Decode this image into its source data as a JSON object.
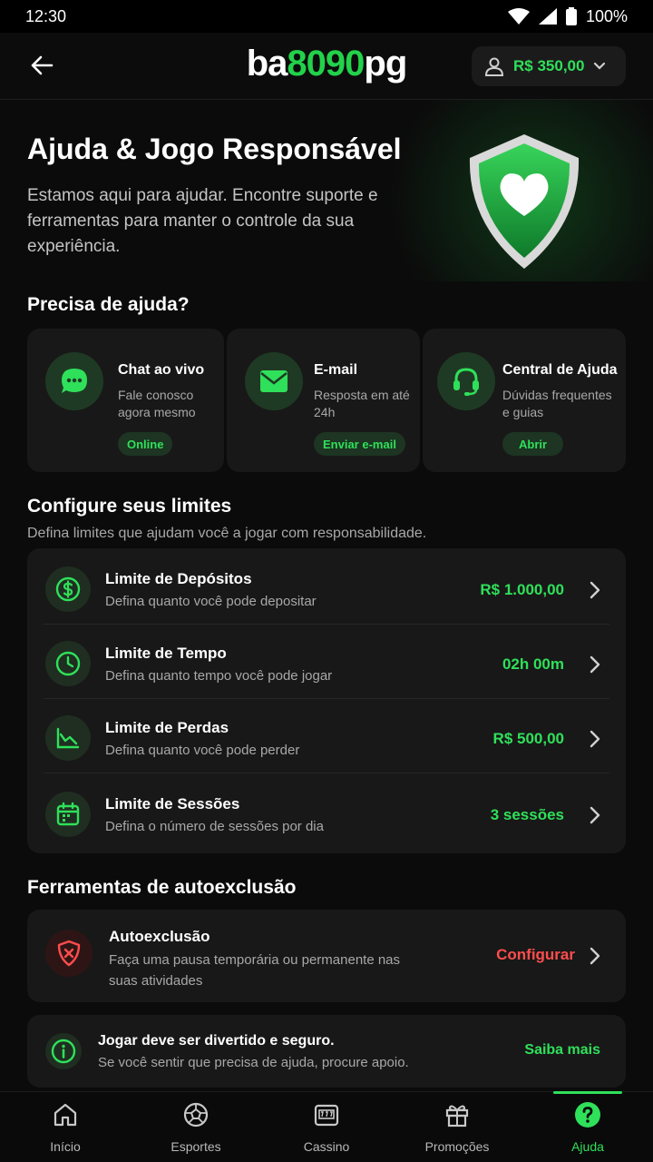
{
  "status_bar": {
    "time": "12:30",
    "battery": "100%"
  },
  "header": {
    "logo": {
      "part1": "ba",
      "part2": "8090",
      "part3": "pg"
    },
    "balance": "R$ 350,00"
  },
  "hero": {
    "title": "Ajuda & Jogo Responsável",
    "subtitle": "Estamos aqui para ajudar. Encontre suporte e ferramentas para manter o controle da sua experiência."
  },
  "help": {
    "title": "Precisa de ajuda?",
    "cards": [
      {
        "icon": "chat-icon",
        "title": "Chat ao vivo",
        "desc": "Fale conosco agora mesmo",
        "pill": "Online"
      },
      {
        "icon": "mail-icon",
        "title": "E-mail",
        "desc": "Resposta em até 24h",
        "pill": "Enviar e-mail"
      },
      {
        "icon": "headset-icon",
        "title": "Central de Ajuda",
        "desc": "Dúvidas frequentes e guias",
        "pill": "Abrir"
      }
    ]
  },
  "limits": {
    "title": "Configure seus limites",
    "subtitle": "Defina limites que ajudam você a jogar com responsabilidade.",
    "rows": [
      {
        "icon": "dollar-icon",
        "title": "Limite de Depósitos",
        "desc": "Defina quanto você pode depositar",
        "value": "R$ 1.000,00"
      },
      {
        "icon": "clock-icon",
        "title": "Limite de Tempo",
        "desc": "Defina quanto tempo você pode jogar",
        "value": "02h 00m"
      },
      {
        "icon": "trend-down-icon",
        "title": "Limite de Perdas",
        "desc": "Defina quanto você pode perder",
        "value": "R$ 500,00"
      },
      {
        "icon": "calendar-icon",
        "title": "Limite de Sessões",
        "desc": "Defina o número de sessões por dia",
        "value": "3 sessões"
      }
    ]
  },
  "self_exclusion": {
    "title": "Ferramentas de autoexclusão",
    "card": {
      "icon": "shield-x-icon",
      "title": "Autoexclusão",
      "desc": "Faça uma pausa temporária ou permanente nas suas atividades",
      "action": "Configurar"
    }
  },
  "info": {
    "title": "Jogar deve ser divertido e seguro.",
    "desc": "Se você sentir que precisa de ajuda, procure apoio.",
    "link": "Saiba mais"
  },
  "bottom_nav": {
    "items": [
      {
        "icon": "home-icon",
        "label": "Início"
      },
      {
        "icon": "ball-icon",
        "label": "Esportes"
      },
      {
        "icon": "slot-icon",
        "label": "Cassino"
      },
      {
        "icon": "gift-icon",
        "label": "Promoções"
      },
      {
        "icon": "help-icon",
        "label": "Ajuda",
        "active": true
      }
    ]
  },
  "colors": {
    "accent": "#2fe05a",
    "danger": "#ff4d4d",
    "background": "#0b0b0b",
    "card": "#181818"
  }
}
